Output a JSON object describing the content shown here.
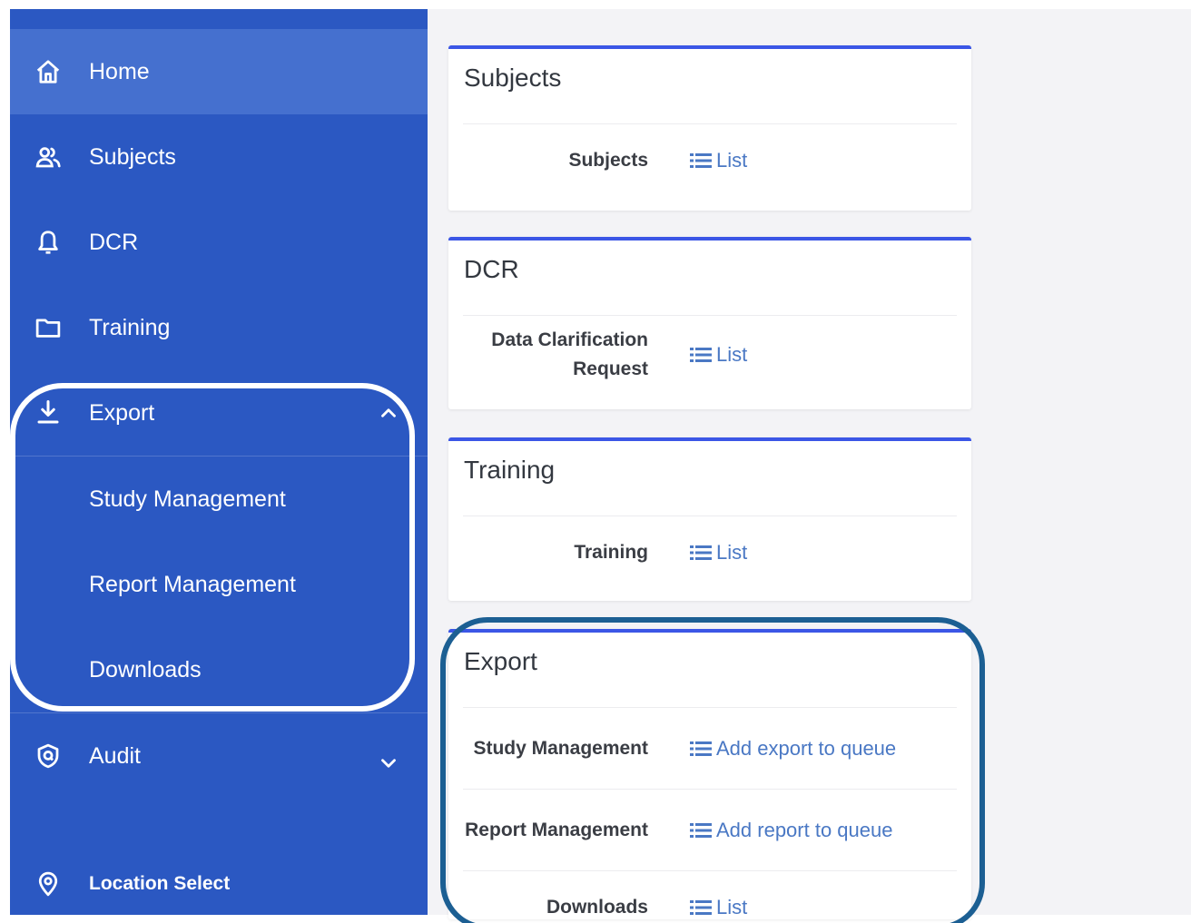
{
  "sidebar": {
    "items": [
      {
        "label": "Home",
        "icon": "home-icon"
      },
      {
        "label": "Subjects",
        "icon": "people-icon"
      },
      {
        "label": "DCR",
        "icon": "bell-icon"
      },
      {
        "label": "Training",
        "icon": "folder-icon"
      },
      {
        "label": "Export",
        "icon": "download-icon",
        "expanded": true,
        "children": [
          "Study Management",
          "Report Management",
          "Downloads"
        ]
      },
      {
        "label": "Audit",
        "icon": "shield-icon",
        "expanded": false
      },
      {
        "label": "Location Select",
        "icon": "location-pin-icon"
      }
    ]
  },
  "cards": [
    {
      "title": "Subjects",
      "rows": [
        {
          "label": "Subjects",
          "link": "List"
        }
      ]
    },
    {
      "title": "DCR",
      "rows": [
        {
          "label": "Data Clarification Request",
          "link": "List"
        }
      ]
    },
    {
      "title": "Training",
      "rows": [
        {
          "label": "Training",
          "link": "List"
        }
      ]
    },
    {
      "title": "Export",
      "rows": [
        {
          "label": "Study Management",
          "link": "Add export to queue"
        },
        {
          "label": "Report Management",
          "link": "Add report to queue"
        },
        {
          "label": "Downloads",
          "link": "List"
        }
      ]
    }
  ],
  "colors": {
    "sidebar_bg": "#2b58c2",
    "sidebar_active": "#4570cf",
    "card_accent": "#3b56e6",
    "link": "#4a78c4",
    "annotation_outline": "#1c5f93"
  }
}
